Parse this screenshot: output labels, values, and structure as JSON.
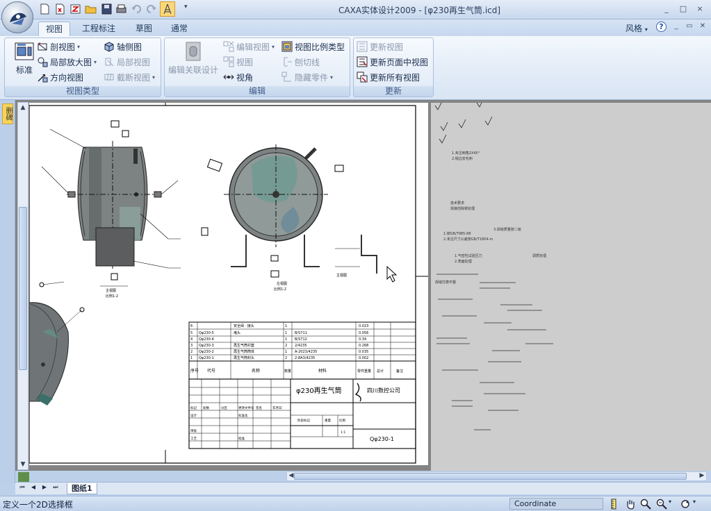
{
  "window": {
    "title": "CAXA实体设计2009 - [φ230再生气筒.icd]",
    "controls": [
      "_",
      "□",
      "×"
    ]
  },
  "tabs": [
    {
      "label": "视图",
      "active": true
    },
    {
      "label": "工程标注",
      "active": false
    },
    {
      "label": "草图",
      "active": false
    },
    {
      "label": "通常",
      "active": false
    }
  ],
  "style_menu": "风格",
  "ribbon": {
    "view_type": {
      "label": "视图类型",
      "standard": "标准",
      "section_view": "剖视图",
      "axonometric_view": "轴侧图",
      "detail_zoom": "局部放大图",
      "local_view": "局部视图",
      "direction_view": "方向视图",
      "broken_view": "截断视图"
    },
    "edit": {
      "label": "编辑",
      "edit_linked_design": "编辑关联设计",
      "edit_view": "编辑视图",
      "view_scale_type": "视图比例类型",
      "view": "视图",
      "section_line": "刨切线",
      "view_angle": "视角",
      "hide_parts": "隐藏零件"
    },
    "update": {
      "label": "更新",
      "update_view": "更新视图",
      "update_page_views": "更新页面中视图",
      "update_all_views": "更新所有视图"
    }
  },
  "side_tab": "删碑",
  "drawing": {
    "part_name": "φ230再生气筒",
    "company": "四川数控公司",
    "drawing_no": "Qφ230-1",
    "front_view_label": "主视图",
    "side_view_label": "左视图",
    "detail_label": "主视图",
    "scale_label": "比例1:2",
    "bom_headers": [
      "序号",
      "代号",
      "名称",
      "数量",
      "材料",
      "零件重量",
      "总计",
      "备注"
    ],
    "bom_rows": [
      [
        "6",
        "",
        "安全阀 · 接头",
        "1",
        "",
        "0.023"
      ],
      [
        "5",
        "Qφ230-5",
        "堵头",
        "1",
        "B/S711",
        "0.056"
      ],
      [
        "4",
        "Qφ230-4",
        "",
        "1",
        "B/S712",
        "0.34"
      ],
      [
        "3",
        "Qφ230-3",
        "再生气筒衬套",
        "2",
        "2/4235",
        "0.268"
      ],
      [
        "2",
        "Qφ230-2",
        "再生气筒筒体",
        "1",
        "A-2023/4235",
        "0.035"
      ],
      [
        "1",
        "Qφ230-1",
        "再生气筒封头",
        "2",
        "2-8A3/4235",
        "0.002"
      ]
    ],
    "title_block": [
      "标记",
      "处数",
      "分区",
      "更改文件号",
      "签名",
      "年月日",
      "设计",
      "标准化",
      "审核",
      "工艺",
      "批准",
      "阶段标记",
      "重量",
      "比例",
      "1:1"
    ]
  },
  "notes": [
    "1.未注倒角2X45°",
    "2.锐边去毛刺",
    "技术要求",
    "焊接前除锈处理",
    "1.按GB/T985-88",
    "2.未注尺寸公差按GB/T1804-m",
    "3.焊缝质量按二级",
    "调质处理",
    "1.气密性试验压力",
    "2.表面处理",
    "焊缝打磨平整"
  ],
  "sheet_tab": "图纸1",
  "status": {
    "prompt": "定义一个2D选择框",
    "coordinate": "Coordinate"
  }
}
